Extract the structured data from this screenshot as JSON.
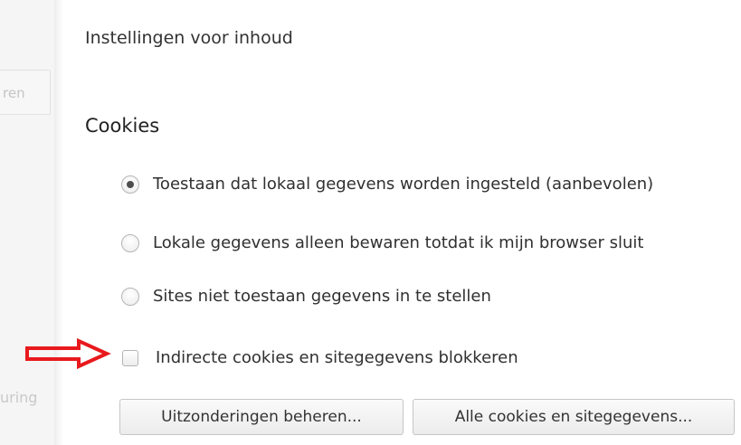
{
  "background": {
    "button_fragment": "ren",
    "text_fragment": "uring"
  },
  "dialog": {
    "title": "Instellingen voor inhoud"
  },
  "cookies": {
    "title": "Cookies",
    "options": [
      {
        "label": "Toestaan dat lokaal gegevens worden ingesteld (aanbevolen)",
        "checked": true
      },
      {
        "label": "Lokale gegevens alleen bewaren totdat ik mijn browser sluit",
        "checked": false
      },
      {
        "label": "Sites niet toestaan gegevens in te stellen",
        "checked": false
      }
    ],
    "block_third_party": {
      "label": "Indirecte cookies en sitegegevens blokkeren",
      "checked": false
    },
    "buttons": {
      "exceptions": "Uitzonderingen beheren...",
      "all_cookies": "Alle cookies en sitegegevens..."
    }
  },
  "annotation": {
    "arrow_color": "#e8191d"
  }
}
